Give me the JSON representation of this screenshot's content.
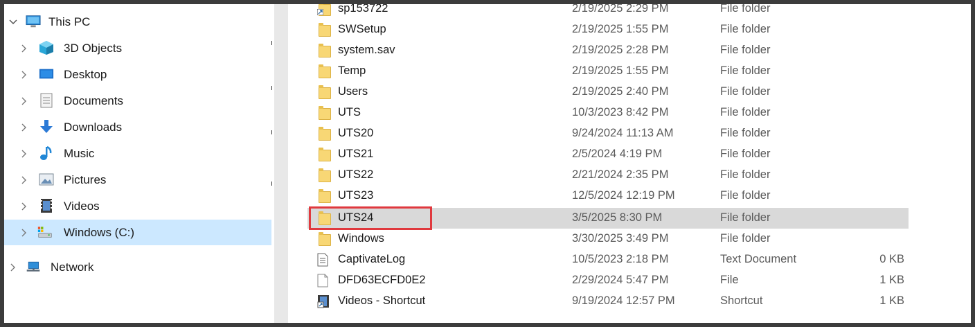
{
  "nav": {
    "items": [
      {
        "label": "This PC",
        "icon": "this-pc-icon",
        "expanded": true
      },
      {
        "label": "3D Objects",
        "icon": "3d-objects-icon"
      },
      {
        "label": "Desktop",
        "icon": "desktop-icon"
      },
      {
        "label": "Documents",
        "icon": "documents-icon"
      },
      {
        "label": "Downloads",
        "icon": "downloads-icon"
      },
      {
        "label": "Music",
        "icon": "music-icon"
      },
      {
        "label": "Pictures",
        "icon": "pictures-icon"
      },
      {
        "label": "Videos",
        "icon": "videos-icon"
      },
      {
        "label": "Windows (C:)",
        "icon": "drive-icon",
        "selected": true
      },
      {
        "label": "Network",
        "icon": "network-icon"
      }
    ]
  },
  "files": {
    "rows": [
      {
        "name": "sp153722",
        "date": "2/19/2025 2:29 PM",
        "type": "File folder",
        "size": "",
        "icon": "folder-shortcut-icon"
      },
      {
        "name": "SWSetup",
        "date": "2/19/2025 1:55 PM",
        "type": "File folder",
        "size": "",
        "icon": "folder-icon"
      },
      {
        "name": "system.sav",
        "date": "2/19/2025 2:28 PM",
        "type": "File folder",
        "size": "",
        "icon": "folder-icon"
      },
      {
        "name": "Temp",
        "date": "2/19/2025 1:55 PM",
        "type": "File folder",
        "size": "",
        "icon": "folder-icon"
      },
      {
        "name": "Users",
        "date": "2/19/2025 2:40 PM",
        "type": "File folder",
        "size": "",
        "icon": "folder-icon"
      },
      {
        "name": "UTS",
        "date": "10/3/2023 8:42 PM",
        "type": "File folder",
        "size": "",
        "icon": "folder-icon"
      },
      {
        "name": "UTS20",
        "date": "9/24/2024 11:13 AM",
        "type": "File folder",
        "size": "",
        "icon": "folder-icon"
      },
      {
        "name": "UTS21",
        "date": "2/5/2024 4:19 PM",
        "type": "File folder",
        "size": "",
        "icon": "folder-icon"
      },
      {
        "name": "UTS22",
        "date": "2/21/2024 2:35 PM",
        "type": "File folder",
        "size": "",
        "icon": "folder-icon"
      },
      {
        "name": "UTS23",
        "date": "12/5/2024 12:19 PM",
        "type": "File folder",
        "size": "",
        "icon": "folder-icon"
      },
      {
        "name": "UTS24",
        "date": "3/5/2025 8:30 PM",
        "type": "File folder",
        "size": "",
        "icon": "folder-icon",
        "selected": true
      },
      {
        "name": "Windows",
        "date": "3/30/2025 3:49 PM",
        "type": "File folder",
        "size": "",
        "icon": "folder-icon"
      },
      {
        "name": "CaptivateLog",
        "date": "10/5/2023 2:18 PM",
        "type": "Text Document",
        "size": "0 KB",
        "icon": "text-document-icon"
      },
      {
        "name": "DFD63ECFD0E2",
        "date": "2/29/2024 5:47 PM",
        "type": "File",
        "size": "1 KB",
        "icon": "file-icon"
      },
      {
        "name": "Videos - Shortcut",
        "date": "9/19/2024 12:57 PM",
        "type": "Shortcut",
        "size": "1 KB",
        "icon": "video-shortcut-icon"
      }
    ]
  },
  "colors": {
    "selection_nav": "#cce8ff",
    "selection_row": "#d9d9d9",
    "highlight_box": "#e0393e",
    "folder": "#f8d775"
  }
}
